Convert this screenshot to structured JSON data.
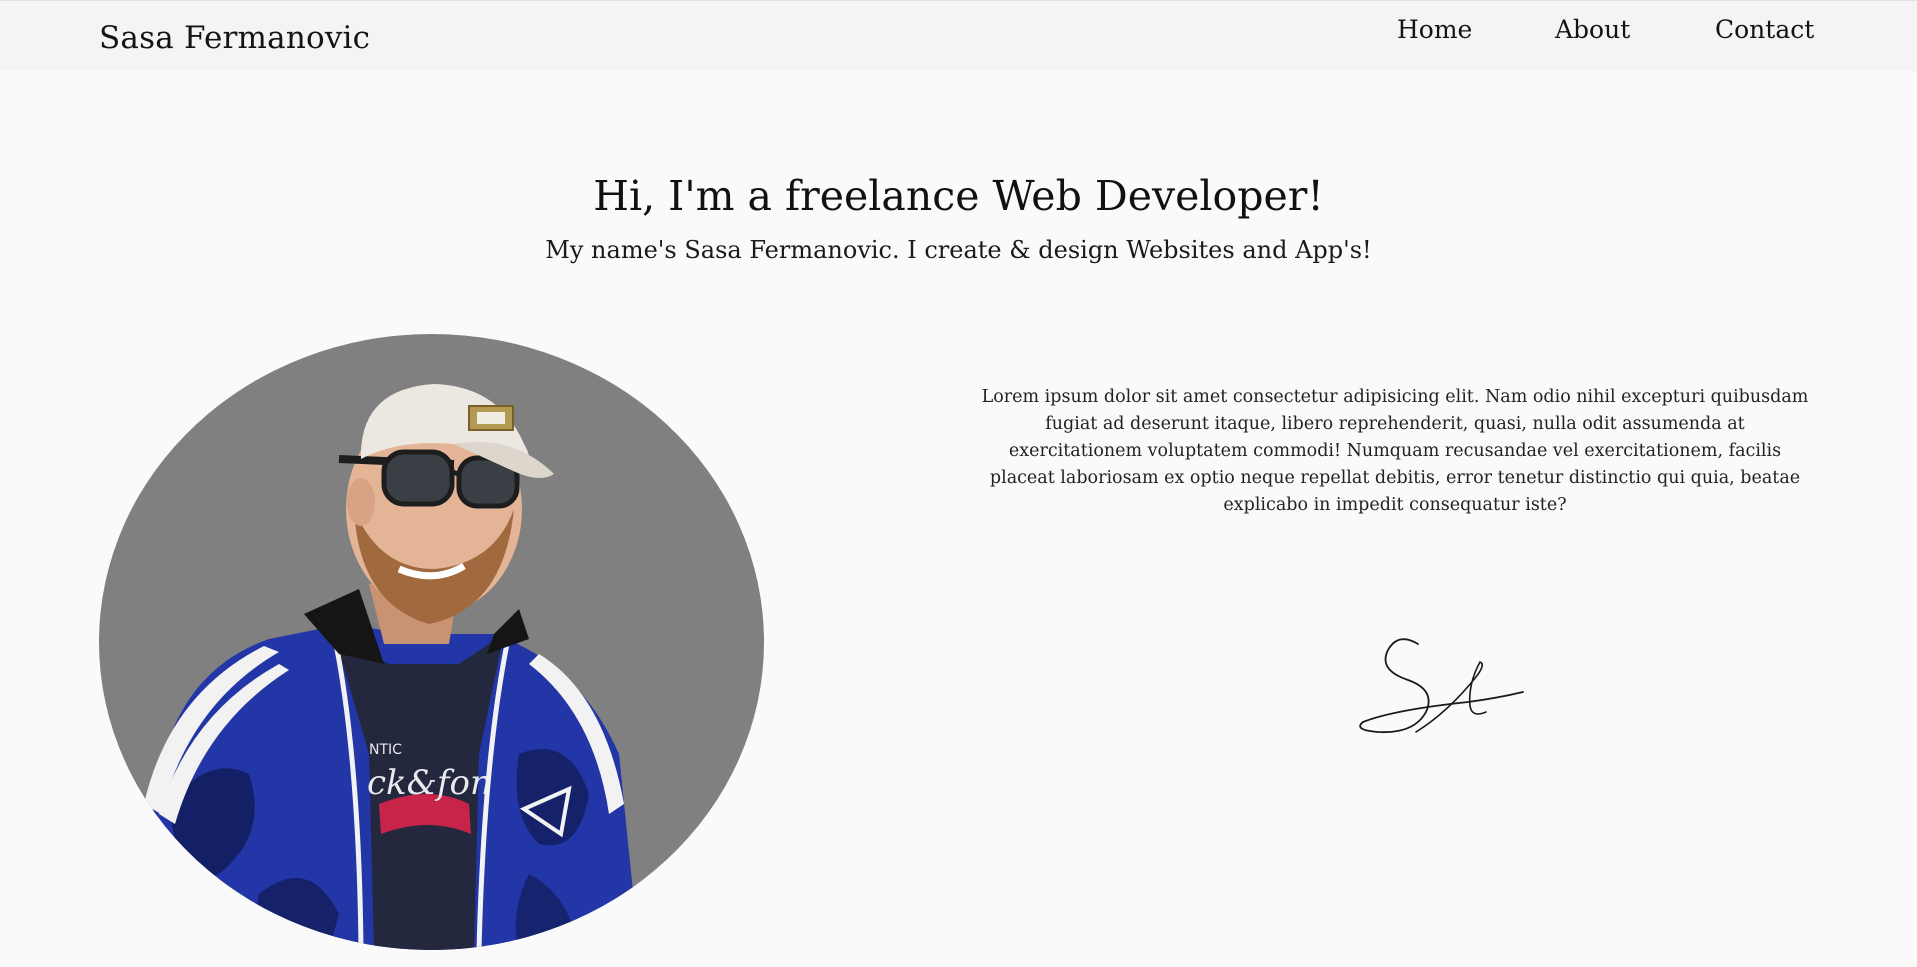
{
  "header": {
    "brand": "Sasa Fermanovic",
    "nav": [
      {
        "label": "Home"
      },
      {
        "label": "About"
      },
      {
        "label": "Contact"
      }
    ]
  },
  "hero": {
    "title": "Hi, I'm a freelance Web Developer!",
    "subtitle": "My name's Sasa Fermanovic. I create & design Websites and App's!"
  },
  "about": {
    "bio": "Lorem ipsum dolor sit amet consectetur adipisicing elit. Nam odio nihil excepturi quibusdam fugiat ad deserunt itaque, libero reprehenderit, quasi, nulla odit assumenda at exercitationem voluptatem commodi! Numquam recusandae vel exercitationem, facilis placeat laboriosam ex optio neque repellat debitis, error tenetur distinctio qui quia, beatae explicabo in impedit consequatur iste?"
  },
  "colors": {
    "page_background": "#fafafa",
    "navbar_background": "#f4f4f4",
    "portrait_background": "#808080",
    "jacket_blue": "#2336a8",
    "text": "#111111"
  },
  "images": {
    "portrait": "portrait-photo",
    "signature": "handwritten-signature"
  }
}
